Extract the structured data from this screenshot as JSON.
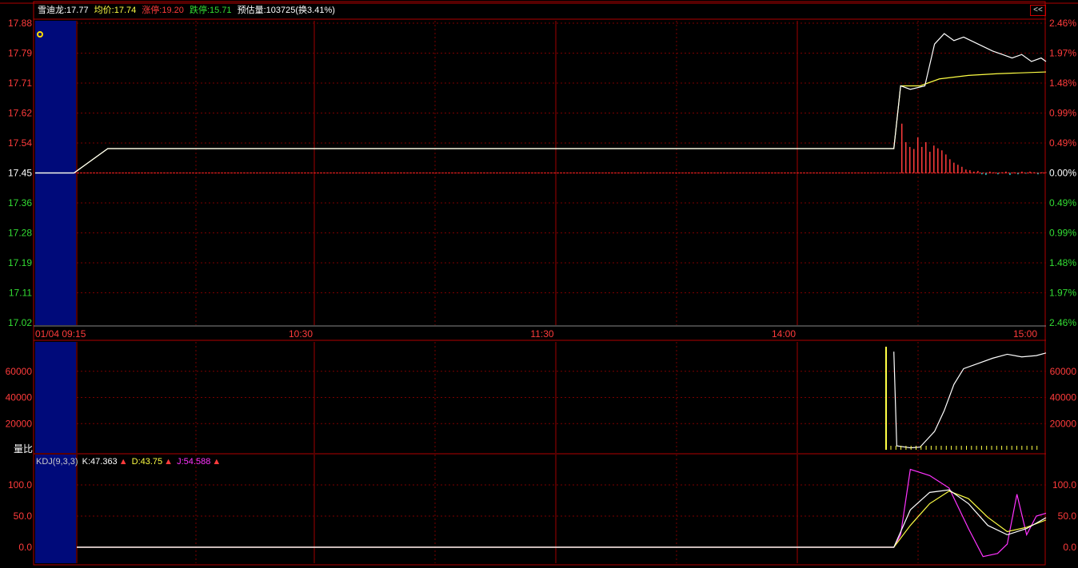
{
  "header": {
    "stock": "雪迪龙:17.77",
    "avg": "均价:17.74",
    "limit_up": "涨停:19.20",
    "limit_down": "跌停:15.71",
    "est_volume": "预估量:103725(换3.41%)",
    "collapse_button": "<<"
  },
  "colors": {
    "up": "#ff3b3b",
    "down": "#33dd33",
    "grid": "#7a0000",
    "price_line": "#ffffff",
    "avg_line": "#ffff44",
    "session_bg": "#000a7a",
    "k_line": "#ffffff",
    "d_line": "#ffff44",
    "j_line": "#ff33ff"
  },
  "volume_panel": {
    "label": "量比"
  },
  "kdj_panel": {
    "name": "KDJ(9,3,3)",
    "k": "K:47.363",
    "d": "D:43.75",
    "j": "J:54.588"
  },
  "chart_data": [
    {
      "type": "line",
      "x_ticks": [
        "01/04 09:15",
        "10:30",
        "11:30",
        "14:00",
        "15:00"
      ],
      "y_left": [
        "17.88",
        "17.79",
        "17.71",
        "17.62",
        "17.54",
        "17.45",
        "17.36",
        "17.28",
        "17.19",
        "17.11",
        "17.02"
      ],
      "y_right": [
        "2.46%",
        "1.97%",
        "1.48%",
        "0.99%",
        "0.49%",
        "0.00%",
        "0.49%",
        "0.99%",
        "1.48%",
        "1.97%",
        "2.46%"
      ],
      "ylim": [
        17.02,
        17.88
      ],
      "prev_close": 17.45,
      "series": [
        {
          "name": "price",
          "points": [
            [
              0,
              17.45
            ],
            [
              0.028,
              17.45
            ],
            [
              0.032,
              17.52
            ],
            [
              0.82,
              17.52
            ],
            [
              0.843,
              17.52
            ],
            [
              0.85,
              17.7
            ],
            [
              0.86,
              17.69
            ],
            [
              0.875,
              17.7
            ],
            [
              0.885,
              17.82
            ],
            [
              0.895,
              17.85
            ],
            [
              0.905,
              17.83
            ],
            [
              0.915,
              17.84
            ],
            [
              0.93,
              17.82
            ],
            [
              0.945,
              17.8
            ],
            [
              0.955,
              17.79
            ],
            [
              0.965,
              17.78
            ],
            [
              0.975,
              17.79
            ],
            [
              0.985,
              17.77
            ],
            [
              0.995,
              17.78
            ],
            [
              1.0,
              17.77
            ]
          ]
        },
        {
          "name": "avg",
          "points": [
            [
              0,
              17.45
            ],
            [
              0.028,
              17.45
            ],
            [
              0.032,
              17.52
            ],
            [
              0.82,
              17.52
            ],
            [
              0.843,
              17.52
            ],
            [
              0.85,
              17.7
            ],
            [
              0.87,
              17.7
            ],
            [
              0.89,
              17.72
            ],
            [
              0.92,
              17.73
            ],
            [
              0.95,
              17.735
            ],
            [
              1.0,
              17.74
            ]
          ]
        }
      ],
      "volume_bars": {
        "start": 0.843,
        "end": 1.0,
        "values_pct": [
          0.72,
          0.45,
          0.38,
          0.35,
          0.52,
          0.38,
          0.45,
          0.31,
          0.4,
          0.36,
          0.33,
          0.27,
          0.2,
          0.15,
          0.12,
          0.09,
          0.05,
          0.04,
          0.02,
          0.03,
          -0.02,
          -0.03,
          0.02,
          0.01,
          -0.02,
          0.01,
          0.02,
          -0.03,
          0.01,
          -0.02,
          0.02,
          -0.01,
          0.02,
          0.01,
          -0.02,
          0.01,
          0.01,
          -0.01
        ]
      }
    },
    {
      "type": "line",
      "title": "量比",
      "y_ticks": [
        60000,
        40000,
        20000
      ],
      "ylim": [
        0,
        80000
      ],
      "series": [
        {
          "name": "ratio",
          "points": [
            [
              0.843,
              75000
            ],
            [
              0.846,
              3000
            ],
            [
              0.86,
              1500
            ],
            [
              0.87,
              2000
            ],
            [
              0.885,
              14000
            ],
            [
              0.895,
              30000
            ],
            [
              0.905,
              50000
            ],
            [
              0.915,
              62000
            ],
            [
              0.93,
              66000
            ],
            [
              0.945,
              70000
            ],
            [
              0.96,
              73000
            ],
            [
              0.975,
              71000
            ],
            [
              0.99,
              72000
            ],
            [
              1.0,
              74000
            ]
          ]
        }
      ]
    },
    {
      "type": "line",
      "title": "KDJ(9,3,3)",
      "y_ticks": [
        100.0,
        50.0,
        0.0
      ],
      "ylim": [
        -20,
        140
      ],
      "series": [
        {
          "name": "K",
          "points": [
            [
              0,
              0
            ],
            [
              0.843,
              0
            ],
            [
              0.86,
              60
            ],
            [
              0.88,
              88
            ],
            [
              0.9,
              92
            ],
            [
              0.92,
              70
            ],
            [
              0.94,
              35
            ],
            [
              0.96,
              20
            ],
            [
              0.98,
              30
            ],
            [
              1.0,
              47.363
            ]
          ]
        },
        {
          "name": "D",
          "points": [
            [
              0,
              0
            ],
            [
              0.843,
              0
            ],
            [
              0.86,
              35
            ],
            [
              0.88,
              70
            ],
            [
              0.9,
              90
            ],
            [
              0.92,
              78
            ],
            [
              0.94,
              48
            ],
            [
              0.96,
              25
            ],
            [
              0.98,
              32
            ],
            [
              1.0,
              43.75
            ]
          ]
        },
        {
          "name": "J",
          "points": [
            [
              0,
              0
            ],
            [
              0.843,
              0
            ],
            [
              0.85,
              20
            ],
            [
              0.86,
              125
            ],
            [
              0.88,
              115
            ],
            [
              0.9,
              95
            ],
            [
              0.92,
              30
            ],
            [
              0.935,
              -15
            ],
            [
              0.95,
              -10
            ],
            [
              0.96,
              5
            ],
            [
              0.97,
              85
            ],
            [
              0.98,
              20
            ],
            [
              0.99,
              50
            ],
            [
              1.0,
              54.588
            ]
          ]
        }
      ]
    }
  ]
}
